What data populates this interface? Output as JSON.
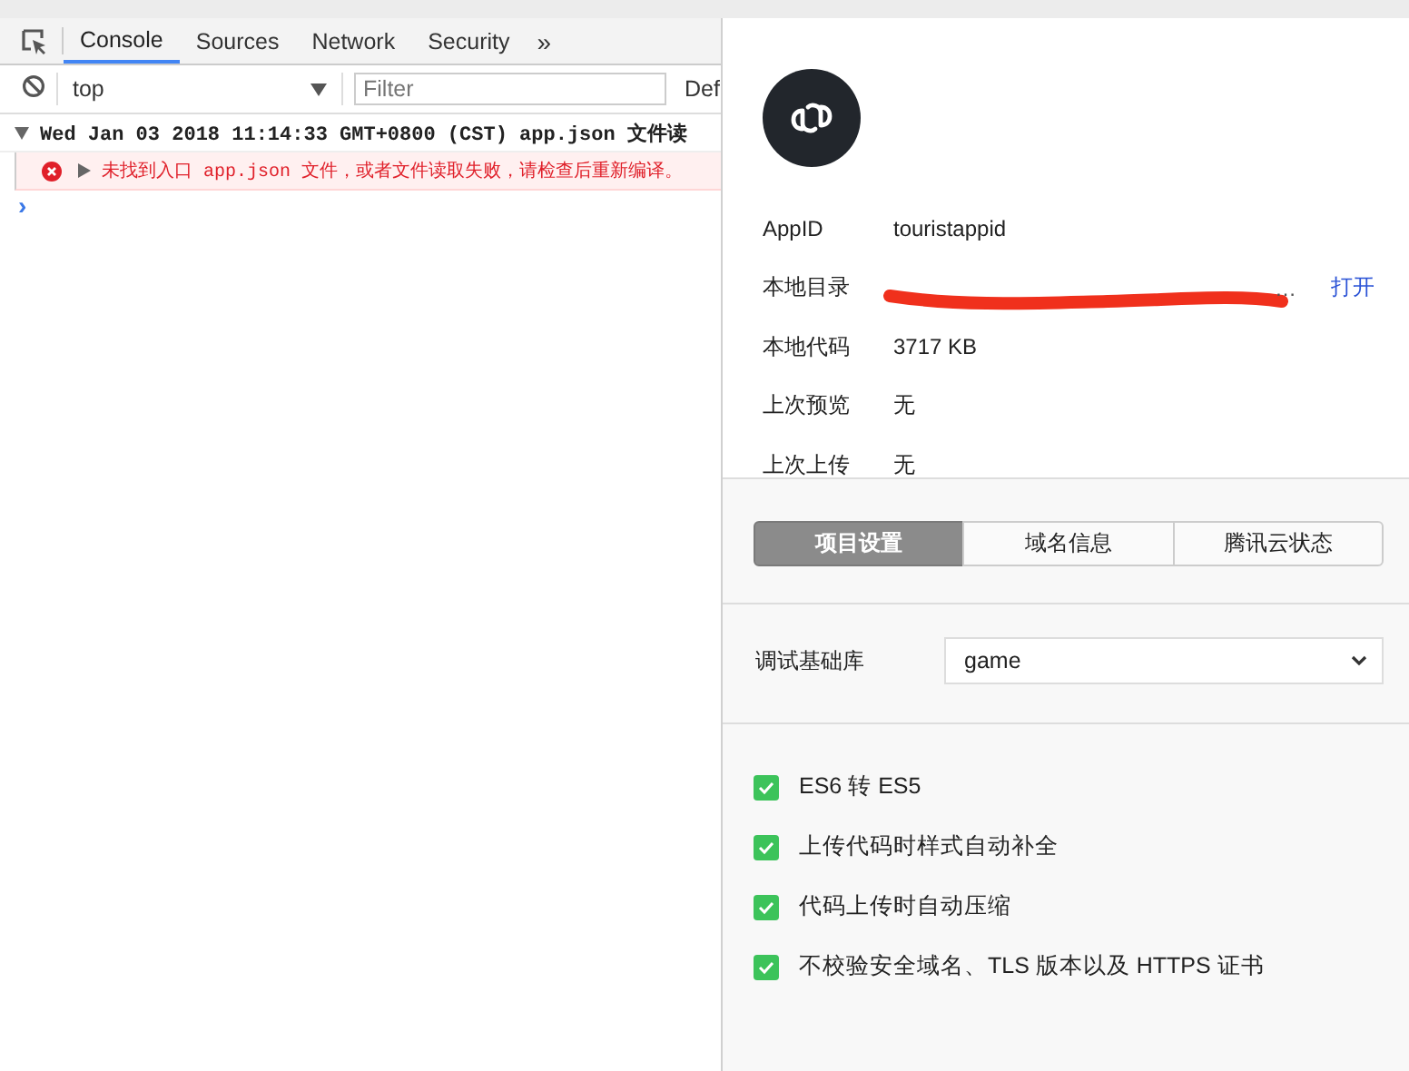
{
  "devtools": {
    "tabs": [
      {
        "label": "Console",
        "selected": true
      },
      {
        "label": "Sources",
        "selected": false
      },
      {
        "label": "Network",
        "selected": false
      },
      {
        "label": "Security",
        "selected": false
      }
    ],
    "more": "»",
    "context": "top",
    "filter_placeholder": "Filter",
    "levels": "Def",
    "console": [
      {
        "kind": "group",
        "expanded": true,
        "text": "Wed Jan 03 2018 11:14:33 GMT+0800 (CST)  app.json 文件读"
      },
      {
        "kind": "error",
        "expanded": false,
        "text": "未找到入口 app.json 文件，或者文件读取失败，请检查后重新编译。"
      }
    ],
    "prompt": "›"
  },
  "project": {
    "info": [
      {
        "label": "AppID",
        "value": "touristappid",
        "redacted": false
      },
      {
        "label": "本地目录",
        "value": "…",
        "redacted": true,
        "action": "打开"
      },
      {
        "label": "本地代码",
        "value": "3717 KB",
        "redacted": false
      },
      {
        "label": "上次预览",
        "value": "无",
        "redacted": false
      },
      {
        "label": "上次上传",
        "value": "无",
        "redacted": false
      }
    ],
    "tabs": [
      {
        "label": "项目设置",
        "selected": true
      },
      {
        "label": "域名信息",
        "selected": false
      },
      {
        "label": "腾讯云状态",
        "selected": false
      }
    ],
    "library": {
      "label": "调试基础库",
      "value": "game"
    },
    "options": [
      {
        "label": "ES6 转 ES5",
        "checked": true
      },
      {
        "label": "上传代码时样式自动补全",
        "checked": true
      },
      {
        "label": "代码上传时自动压缩",
        "checked": true
      },
      {
        "label": "不校验安全域名、TLS 版本以及 HTTPS 证书",
        "checked": true
      }
    ]
  }
}
